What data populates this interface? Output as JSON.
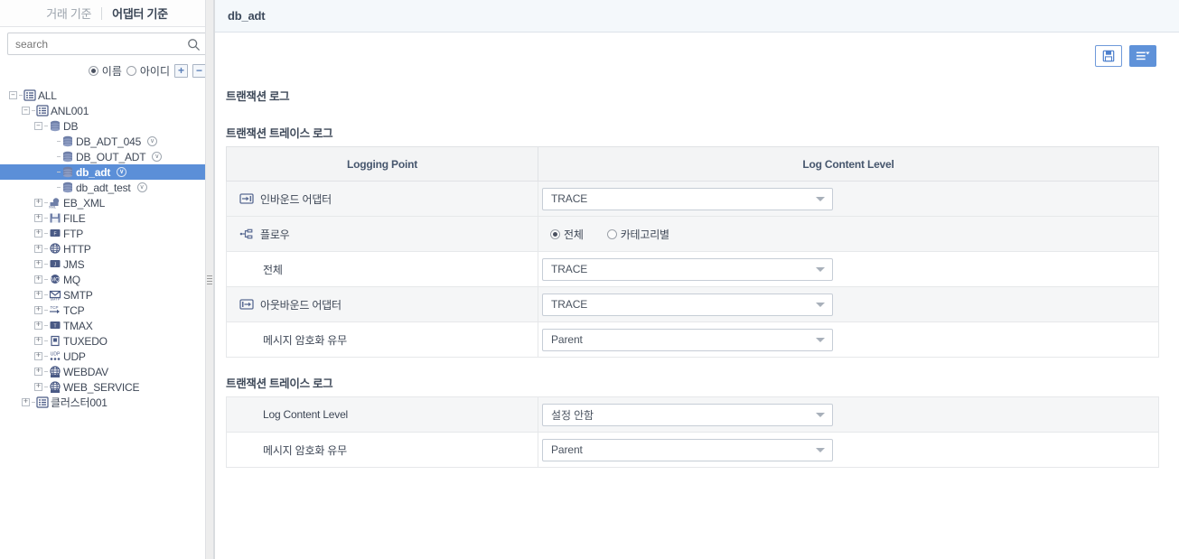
{
  "sidebar": {
    "tabs": [
      {
        "label": "거래 기준",
        "active": false
      },
      {
        "label": "어댑터 기준",
        "active": true
      }
    ],
    "search": {
      "placeholder": "search",
      "value": "",
      "icon": "search-icon"
    },
    "options": {
      "radios": [
        {
          "label": "이름",
          "selected": true
        },
        {
          "label": "아이디",
          "selected": false
        }
      ],
      "expand_all_label": "+",
      "collapse_all_label": "−"
    },
    "tree": [
      {
        "label": "ALL",
        "depth": 0,
        "toggle": "minus",
        "icon": "list-icon",
        "badge": false,
        "selected": false
      },
      {
        "label": "ANL001",
        "depth": 1,
        "toggle": "minus",
        "icon": "list-icon",
        "badge": false,
        "selected": false
      },
      {
        "label": "DB",
        "depth": 2,
        "toggle": "minus",
        "icon": "db-icon",
        "badge": false,
        "selected": false
      },
      {
        "label": "DB_ADT_045",
        "depth": 3,
        "toggle": "leaf",
        "icon": "db-icon",
        "badge": true,
        "selected": false
      },
      {
        "label": "DB_OUT_ADT",
        "depth": 3,
        "toggle": "leaf",
        "icon": "db-icon",
        "badge": true,
        "selected": false
      },
      {
        "label": "db_adt",
        "depth": 3,
        "toggle": "leaf",
        "icon": "db-icon",
        "badge": true,
        "selected": true
      },
      {
        "label": "db_adt_test",
        "depth": 3,
        "toggle": "leaf",
        "icon": "db-icon",
        "badge": true,
        "selected": false
      },
      {
        "label": "EB_XML",
        "depth": 2,
        "toggle": "plus",
        "icon": "ebxml-icon",
        "badge": false,
        "selected": false
      },
      {
        "label": "FILE",
        "depth": 2,
        "toggle": "plus",
        "icon": "file-icon",
        "badge": false,
        "selected": false
      },
      {
        "label": "FTP",
        "depth": 2,
        "toggle": "plus",
        "icon": "ftp-icon",
        "badge": false,
        "selected": false
      },
      {
        "label": "HTTP",
        "depth": 2,
        "toggle": "plus",
        "icon": "globe-icon",
        "badge": false,
        "selected": false
      },
      {
        "label": "JMS",
        "depth": 2,
        "toggle": "plus",
        "icon": "jms-icon",
        "badge": false,
        "selected": false
      },
      {
        "label": "MQ",
        "depth": 2,
        "toggle": "plus",
        "icon": "mq-icon",
        "badge": false,
        "selected": false
      },
      {
        "label": "SMTP",
        "depth": 2,
        "toggle": "plus",
        "icon": "smtp-icon",
        "badge": false,
        "selected": false
      },
      {
        "label": "TCP",
        "depth": 2,
        "toggle": "plus",
        "icon": "tcp-icon",
        "badge": false,
        "selected": false
      },
      {
        "label": "TMAX",
        "depth": 2,
        "toggle": "plus",
        "icon": "tmax-icon",
        "badge": false,
        "selected": false
      },
      {
        "label": "TUXEDO",
        "depth": 2,
        "toggle": "plus",
        "icon": "tuxedo-icon",
        "badge": false,
        "selected": false
      },
      {
        "label": "UDP",
        "depth": 2,
        "toggle": "plus",
        "icon": "udp-icon",
        "badge": false,
        "selected": false
      },
      {
        "label": "WEBDAV",
        "depth": 2,
        "toggle": "plus",
        "icon": "webdav-icon",
        "badge": false,
        "selected": false
      },
      {
        "label": "WEB_SERVICE",
        "depth": 2,
        "toggle": "plus",
        "icon": "ws-icon",
        "badge": false,
        "selected": false
      },
      {
        "label": "클러스터001",
        "depth": 1,
        "toggle": "plus",
        "icon": "list-icon",
        "badge": false,
        "selected": false
      }
    ]
  },
  "main": {
    "title": "db_adt",
    "toolbar": [
      {
        "name": "save-button",
        "icon": "save-icon",
        "style": "ghost"
      },
      {
        "name": "menu-button",
        "icon": "list-menu-icon",
        "style": "solid"
      }
    ],
    "section_title": "트랜잭션 로그",
    "table1": {
      "title": "트랜잭션 트레이스 로그",
      "headers": [
        "Logging Point",
        "Log Content Level"
      ],
      "rows": [
        {
          "label": "인바운드 어댑터",
          "icon": "inbound-adapter-icon",
          "indent": false,
          "shaded": true,
          "control": "select",
          "value": "TRACE"
        },
        {
          "label": "플로우",
          "icon": "flow-icon",
          "indent": false,
          "shaded": true,
          "control": "radio",
          "radios": [
            {
              "label": "전체",
              "selected": true
            },
            {
              "label": "카테고리별",
              "selected": false
            }
          ]
        },
        {
          "label": "전체",
          "icon": "",
          "indent": true,
          "shaded": false,
          "control": "select",
          "value": "TRACE"
        },
        {
          "label": "아웃바운드 어댑터",
          "icon": "outbound-adapter-icon",
          "indent": false,
          "shaded": true,
          "control": "select",
          "value": "TRACE"
        },
        {
          "label": "메시지 암호화 유무",
          "icon": "",
          "indent": true,
          "shaded": false,
          "control": "select",
          "value": "Parent"
        }
      ]
    },
    "table2": {
      "title": "트랜잭션 트레이스 로그",
      "rows": [
        {
          "label": "Log Content Level",
          "shaded": true,
          "control": "select",
          "value": "설정 안함"
        },
        {
          "label": "메시지 암호화 유무",
          "shaded": false,
          "control": "select",
          "value": "Parent"
        }
      ]
    }
  },
  "colors": {
    "accent": "#5b8fd8",
    "header_bg": "#f4f8fb",
    "row_shade": "#f5f6f7",
    "text": "#3e4756"
  }
}
